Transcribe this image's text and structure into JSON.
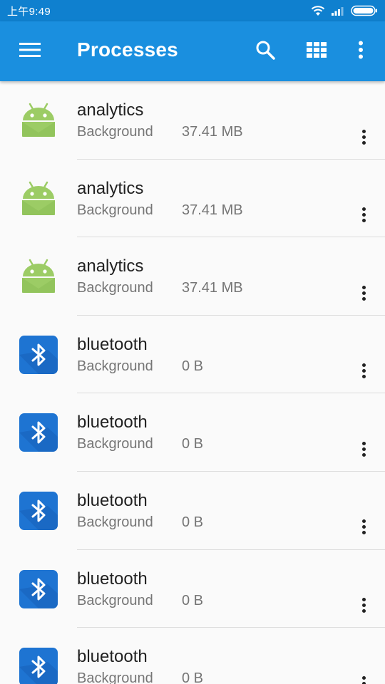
{
  "status_bar": {
    "time": "上午9:49",
    "icons": [
      "wifi-icon",
      "signal-icon",
      "battery-icon"
    ]
  },
  "app_bar": {
    "title": "Processes",
    "icons": [
      "menu-icon",
      "search-icon",
      "grid-view-icon",
      "more-vert-icon"
    ]
  },
  "colors": {
    "status_bar": "#0f80cf",
    "app_bar": "#1a8fdf",
    "android_green": "#9ccc65",
    "bluetooth_blue": "#1e74d2"
  },
  "processes": [
    {
      "name": "analytics",
      "state": "Background",
      "size": "37.41 MB",
      "icon": "android-icon"
    },
    {
      "name": "analytics",
      "state": "Background",
      "size": "37.41 MB",
      "icon": "android-icon"
    },
    {
      "name": "analytics",
      "state": "Background",
      "size": "37.41 MB",
      "icon": "android-icon"
    },
    {
      "name": "bluetooth",
      "state": "Background",
      "size": "0 B",
      "icon": "bluetooth-icon"
    },
    {
      "name": "bluetooth",
      "state": "Background",
      "size": "0 B",
      "icon": "bluetooth-icon"
    },
    {
      "name": "bluetooth",
      "state": "Background",
      "size": "0 B",
      "icon": "bluetooth-icon"
    },
    {
      "name": "bluetooth",
      "state": "Background",
      "size": "0 B",
      "icon": "bluetooth-icon"
    },
    {
      "name": "bluetooth",
      "state": "Background",
      "size": "0 B",
      "icon": "bluetooth-icon"
    }
  ]
}
